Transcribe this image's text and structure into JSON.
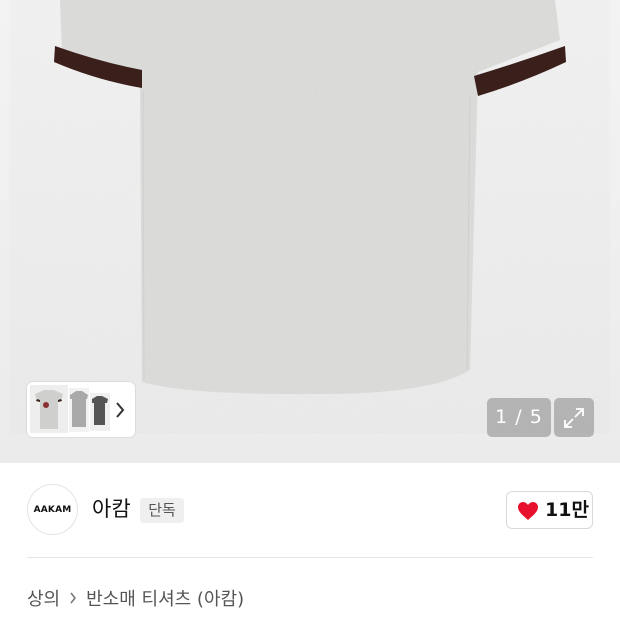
{
  "gallery": {
    "current_page": "1",
    "separator": "/",
    "total_pages": "5",
    "counter_text": "1 / 5",
    "expand_icon": "expand-arrows-icon",
    "thumbnail_next_icon": "chevron-right-icon"
  },
  "product": {
    "shirt_color": "#dcdcda",
    "trim_color": "#3a1f1b"
  },
  "brand": {
    "logo_text": "AAKAM",
    "name": "아캄",
    "badge": "단독"
  },
  "like": {
    "icon": "heart-icon",
    "count": "11만",
    "color": "#e8112d"
  },
  "breadcrumb": {
    "category": "상의",
    "subcategory": "반소매 티셔츠 (아캄)",
    "separator_icon": "chevron-right-icon"
  }
}
